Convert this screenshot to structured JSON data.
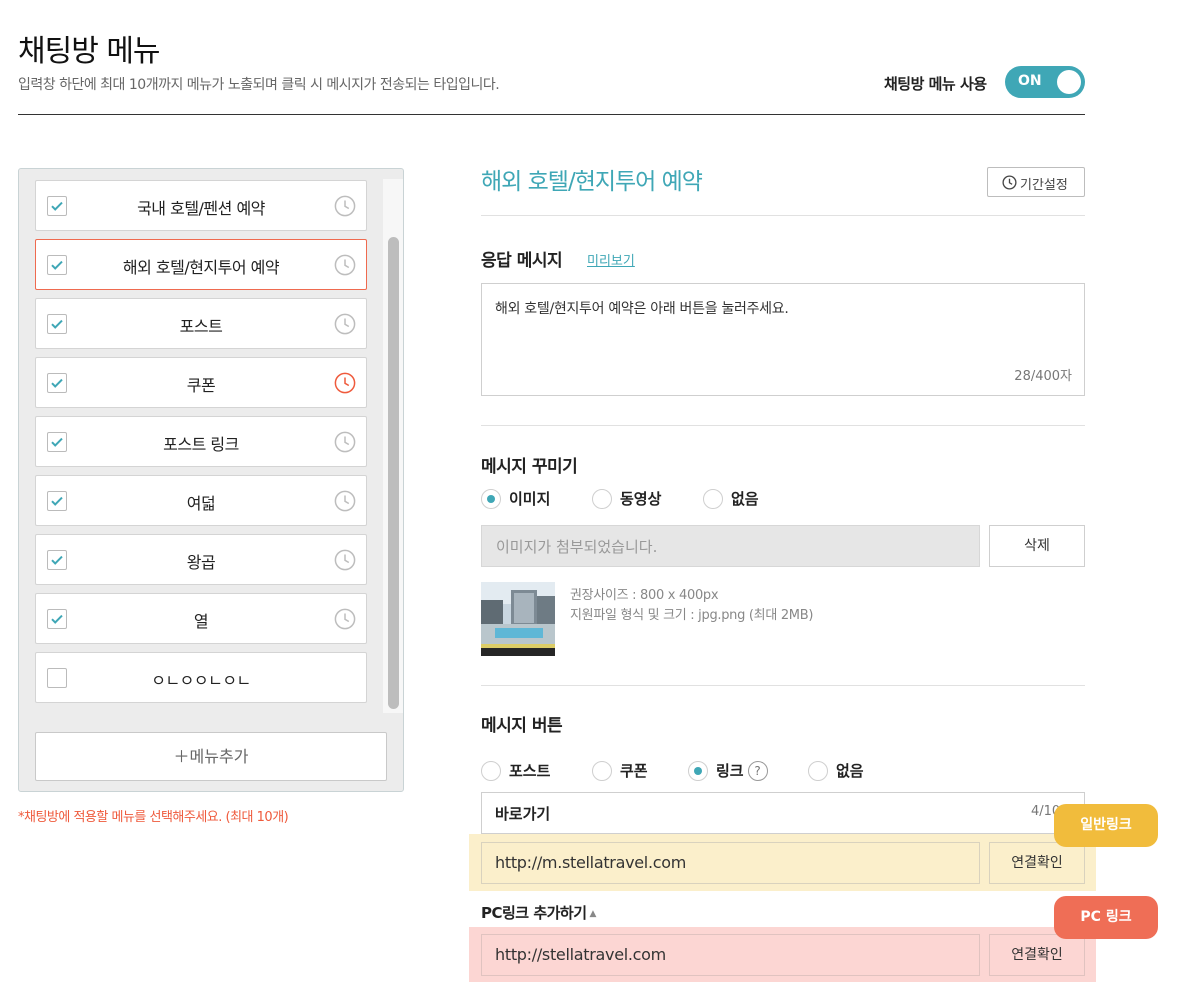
{
  "header": {
    "title": "채팅방 메뉴",
    "subtitle": "입력창 하단에 최대 10개까지 메뉴가 노출되며 클릭 시 메시지가 전송되는 타입입니다.",
    "toggle_label": "채팅방 메뉴 사용",
    "toggle_state": "ON"
  },
  "menu": {
    "items": [
      {
        "label": "국내 호텔/펜션 예약",
        "checked": true,
        "schedule_active": false
      },
      {
        "label": "해외 호텔/현지투어 예약",
        "checked": true,
        "schedule_active": false
      },
      {
        "label": "포스트",
        "checked": true,
        "schedule_active": false
      },
      {
        "label": "쿠폰",
        "checked": true,
        "schedule_active": true
      },
      {
        "label": "포스트 링크",
        "checked": true,
        "schedule_active": false
      },
      {
        "label": "여덟",
        "checked": true,
        "schedule_active": false
      },
      {
        "label": "왕곱",
        "checked": true,
        "schedule_active": false
      },
      {
        "label": "열",
        "checked": true,
        "schedule_active": false
      },
      {
        "label": "ㅇㄴㅇㅇㄴㅇㄴ",
        "checked": false,
        "schedule_active": false
      }
    ],
    "selected_index": 1,
    "add_button": "＋메뉴추가",
    "note": "*채팅방에 적용할 메뉴를 선택해주세요. (최대 10개)"
  },
  "detail": {
    "title": "해외 호텔/현지투어 예약",
    "period_button": "기간설정",
    "reply": {
      "label": "응답 메시지",
      "preview_link": "미리보기",
      "text": "해외 호텔/현지투어 예약은 아래 버튼을 눌러주세요.",
      "count": "28/400자"
    },
    "decorate": {
      "label": "메시지 꾸미기",
      "options": [
        "이미지",
        "동영상",
        "없음"
      ],
      "selected": "이미지",
      "image_status": "이미지가 첨부되었습니다.",
      "delete_button": "삭제",
      "info_size": "권장사이즈 : 800 x 400px",
      "info_format": "지원파일 형식 및 크기 : jpg.png (최대 2MB)"
    },
    "button": {
      "label": "메시지 버튼",
      "options": [
        "포스트",
        "쿠폰",
        "링크",
        "없음"
      ],
      "selected": "링크",
      "help_icon": "?",
      "name_value": "바로가기",
      "name_count": "4/10",
      "mobile_url": "http://m.stellatravel.com",
      "verify_button": "연결확인",
      "pc_link_toggle": "PC링크 추가하기",
      "pc_url": "http://stellatravel.com"
    }
  },
  "annotations": {
    "general_link": "일반링크",
    "pc_link": "PC 링크"
  },
  "colors": {
    "accent": "#3fa7b6",
    "alert": "#ef5a3c",
    "highlight_yellow": "#fbefcb",
    "highlight_red": "#fcd6d3"
  }
}
